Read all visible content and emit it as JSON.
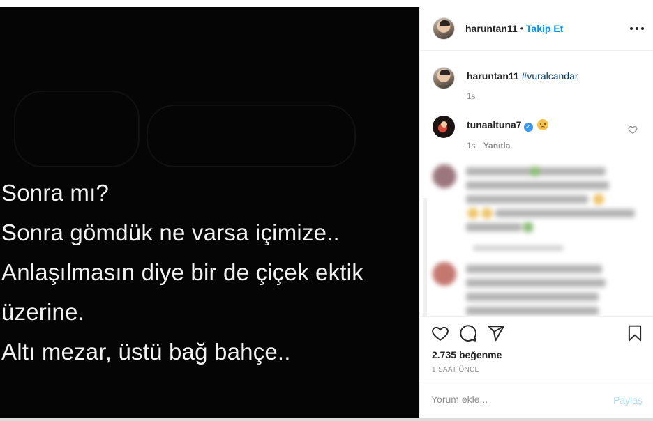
{
  "post": {
    "username": "haruntan11",
    "separator": "•",
    "follow_label": "Takip Et",
    "more_icon": "more-options-icon",
    "image_text": [
      "Sonra mı?",
      "Sonra gömdük ne varsa içimize..",
      "Anlaşılmasın diye bir de çiçek ektik",
      "üzerine.",
      "Altı mezar, üstü bağ bahçe.."
    ]
  },
  "caption": {
    "username": "haruntan11",
    "hashtag": "#vuralcandar",
    "time": "1s"
  },
  "comment": {
    "username": "tunaaltuna7",
    "emoji": "pensive-face-emoji",
    "time": "1s",
    "reply_label": "Yanıtla"
  },
  "actions": {
    "likes_count": "2.735",
    "likes_word": "beğenme",
    "posted_time": "1 SAAT ÖNCE"
  },
  "composer": {
    "placeholder": "Yorum ekle...",
    "post_label": "Paylaş"
  },
  "colors": {
    "accent": "#0095f6",
    "post_disabled": "#b2dffc",
    "hashtag": "#00376b",
    "muted": "#8e8e8e"
  }
}
